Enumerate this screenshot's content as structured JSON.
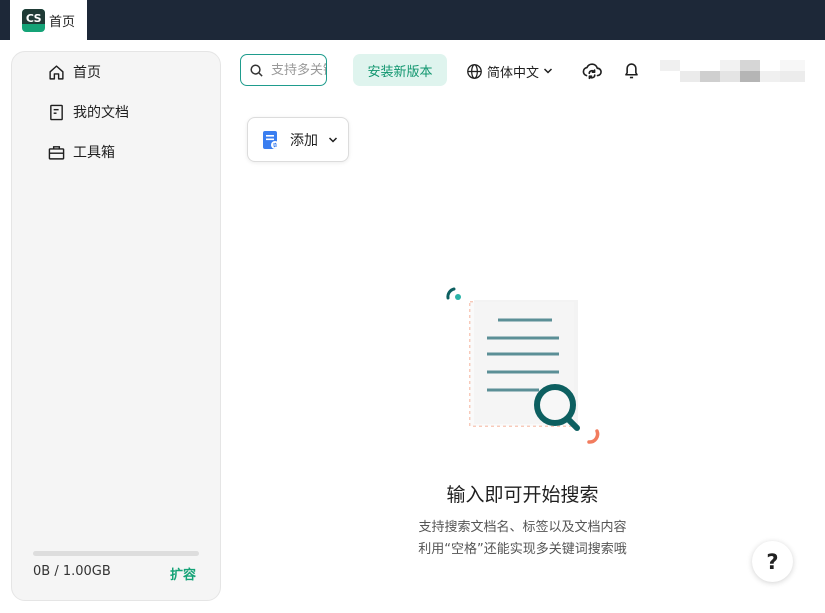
{
  "tab": {
    "logo_text": "CS",
    "title": "首页"
  },
  "sidebar": {
    "items": [
      {
        "label": "首页",
        "icon": "home-icon"
      },
      {
        "label": "我的文档",
        "icon": "document-icon"
      },
      {
        "label": "工具箱",
        "icon": "toolbox-icon"
      }
    ],
    "storage": {
      "text": "0B / 1.00GB",
      "used_fraction": 0,
      "expand_label": "扩容"
    }
  },
  "header": {
    "search_placeholder": "支持多关键词搜索",
    "install_label": "安装新版本",
    "language_label": "简体中文",
    "icons": [
      "cloud-sync-icon",
      "bell-icon"
    ]
  },
  "toolbar": {
    "add_label": "添加"
  },
  "empty_state": {
    "title": "输入即可开始搜索",
    "line1": "支持搜索文档名、标签以及文档内容",
    "line2": "利用“空格”还能实现多关键词搜索哦"
  },
  "help": {
    "label": "?"
  },
  "colors": {
    "accent": "#15a377",
    "tabbar": "#1d2838",
    "sidebar_bg": "#f5f5f5",
    "install_bg": "#dff4ee"
  }
}
